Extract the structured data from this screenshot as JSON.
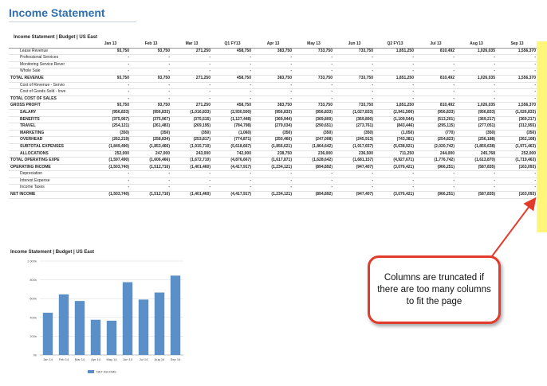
{
  "page": {
    "title": "Income Statement",
    "subtitle": "Income Statement  |  Budget  |  US East"
  },
  "table": {
    "columns": [
      "",
      "Jan 13",
      "Feb 13",
      "Mar 13",
      "Q1 FY13",
      "Apr 13",
      "May 13",
      "Jun 13",
      "Q2 FY13",
      "Jul 13",
      "Aug 13",
      "Sep 13"
    ],
    "rows": [
      {
        "label": "Lease Revenue",
        "level": 1,
        "bold": false,
        "values": [
          "93,750",
          "93,750",
          "271,250",
          "458,750",
          "383,750",
          "733,750",
          "733,750",
          "1,851,250",
          "810,492",
          "1,026,035",
          "1,556,370"
        ]
      },
      {
        "label": "Professional Services",
        "level": 1,
        "bold": false,
        "values": [
          "-",
          "-",
          "-",
          "-",
          "-",
          "-",
          "-",
          "-",
          "-",
          "-",
          "-"
        ]
      },
      {
        "label": "Monitoring Service Rever",
        "level": 1,
        "bold": false,
        "values": [
          "-",
          "-",
          "-",
          "-",
          "-",
          "-",
          "-",
          "-",
          "-",
          "-",
          "-"
        ]
      },
      {
        "label": "Whole Sale",
        "level": 1,
        "bold": false,
        "values": [
          "-",
          "-",
          "-",
          "-",
          "-",
          "-",
          "-",
          "-",
          "-",
          "-",
          "-"
        ]
      },
      {
        "label": "TOTAL REVENUE",
        "level": 0,
        "bold": true,
        "values": [
          "93,750",
          "93,750",
          "271,250",
          "458,750",
          "383,750",
          "733,750",
          "733,750",
          "1,851,250",
          "810,492",
          "1,026,035",
          "1,556,370"
        ]
      },
      {
        "label": "Cost of Revenue - Servio",
        "level": 1,
        "bold": false,
        "values": [
          "-",
          "-",
          "-",
          "-",
          "-",
          "-",
          "-",
          "-",
          "-",
          "-",
          "-"
        ]
      },
      {
        "label": "Cost of Goods Sold - Inve",
        "level": 1,
        "bold": false,
        "values": [
          "-",
          "-",
          "-",
          "-",
          "-",
          "-",
          "-",
          "-",
          "-",
          "-",
          "-"
        ]
      },
      {
        "label": "TOTAL COST OF SALES",
        "level": 0,
        "bold": true,
        "values": [
          "-",
          "-",
          "-",
          "-",
          "-",
          "-",
          "-",
          "-",
          "-",
          "-",
          "-"
        ]
      },
      {
        "label": "GROSS PROFIT",
        "level": 0,
        "bold": true,
        "values": [
          "93,750",
          "93,750",
          "271,250",
          "458,750",
          "383,750",
          "733,750",
          "733,750",
          "1,851,250",
          "810,492",
          "1,026,035",
          "1,556,370"
        ]
      },
      {
        "label": "SALARY",
        "level": 1,
        "bold": true,
        "values": [
          "(956,833)",
          "(956,833)",
          "(1,016,833)",
          "(2,930,500)",
          "(956,833)",
          "(956,833)",
          "(1,027,833)",
          "(2,941,500)",
          "(956,833)",
          "(956,833)",
          "(1,026,833)"
        ]
      },
      {
        "label": "BENEFITS",
        "level": 1,
        "bold": true,
        "values": [
          "(375,967)",
          "(375,967)",
          "(375,515)",
          "(1,127,448)",
          "(369,944)",
          "(369,800)",
          "(369,800)",
          "(1,109,544)",
          "(513,201)",
          "(369,217)",
          "(369,217)"
        ]
      },
      {
        "label": "TRAVEL",
        "level": 1,
        "bold": true,
        "values": [
          "(254,121)",
          "(261,483)",
          "(269,195)",
          "(784,798)",
          "(279,034)",
          "(290,651)",
          "(273,761)",
          "(843,446)",
          "(295,115)",
          "(277,051)",
          "(312,955)"
        ]
      },
      {
        "label": "MARKETING",
        "level": 1,
        "bold": true,
        "values": [
          "(350)",
          "(350)",
          "(350)",
          "(1,060)",
          "(350)",
          "(350)",
          "(350)",
          "(1,050)",
          "(770)",
          "(350)",
          "(350)"
        ]
      },
      {
        "label": "OVERHEAD",
        "level": 1,
        "bold": true,
        "values": [
          "(262,219)",
          "(258,834)",
          "(253,817)",
          "(774,871)",
          "(250,460)",
          "(247,008)",
          "(245,913)",
          "(743,381)",
          "(254,823)",
          "(256,188)",
          "(262,108)"
        ]
      },
      {
        "label": "SUBTOTAL EXPENSES",
        "level": 1,
        "bold": true,
        "values": [
          "(1,849,490)",
          "(1,853,466)",
          "(1,915,710)",
          "(5,618,667)",
          "(1,856,621)",
          "(1,864,642)",
          "(1,917,657)",
          "(5,638,921)",
          "(2,020,742)",
          "(1,859,638)",
          "(1,971,463)"
        ]
      },
      {
        "label": "ALLOCATIONS",
        "level": 1,
        "bold": true,
        "values": [
          "252,000",
          "247,000",
          "243,000",
          "742,000",
          "238,750",
          "236,000",
          "236,500",
          "711,250",
          "244,000",
          "245,768",
          "252,000"
        ]
      },
      {
        "label": "TOTAL OPERATING EXPE",
        "level": 0,
        "bold": true,
        "values": [
          "(1,597,490)",
          "(1,606,466)",
          "(1,672,710)",
          "(4,876,667)",
          "(1,617,871)",
          "(1,628,642)",
          "(1,681,157)",
          "(4,927,671)",
          "(1,776,742)",
          "(1,613,870)",
          "(1,719,463)"
        ]
      },
      {
        "label": "OPERATING INCOME",
        "level": 0,
        "bold": true,
        "values": [
          "(1,503,740)",
          "(1,512,716)",
          "(1,401,460)",
          "(4,417,917)",
          "(1,234,121)",
          "(894,892)",
          "(947,407)",
          "(3,076,421)",
          "(966,251)",
          "(587,835)",
          "(163,093)"
        ]
      },
      {
        "label": "Depreciation",
        "level": 1,
        "bold": false,
        "values": [
          "-",
          "-",
          "-",
          "-",
          "-",
          "-",
          "-",
          "-",
          "-",
          "-",
          "-"
        ]
      },
      {
        "label": "Interest Expense",
        "level": 1,
        "bold": false,
        "values": [
          "-",
          "-",
          "-",
          "-",
          "-",
          "-",
          "-",
          "-",
          "-",
          "-",
          "-"
        ]
      },
      {
        "label": "Income Taxes",
        "level": 1,
        "bold": false,
        "values": [
          "-",
          "-",
          "-",
          "-",
          "-",
          "-",
          "-",
          "-",
          "-",
          "-",
          "-"
        ]
      },
      {
        "label": "NET INCOME",
        "level": 0,
        "bold": true,
        "values": [
          "(1,503,740)",
          "(1,512,716)",
          "(1,401,460)",
          "(4,417,917)",
          "(1,234,121)",
          "(894,892)",
          "(947,407)",
          "(3,076,421)",
          "(966,251)",
          "(587,835)",
          "(163,093)"
        ]
      }
    ]
  },
  "chart_data": {
    "type": "bar",
    "title": "Income Statement | Budget | US East",
    "categories": [
      "Jan 14",
      "Feb 14",
      "Mar 14",
      "Apr 14",
      "May 14",
      "Jun 14",
      "Jul 14",
      "Aug 14",
      "Sep 14"
    ],
    "series": [
      {
        "name": "NET INCOME",
        "values": [
          450000,
          645000,
          575000,
          375000,
          365000,
          775000,
          590000,
          665000,
          845000
        ],
        "color": "#5b8fc7"
      }
    ],
    "yticks": [
      "0k",
      "200k",
      "400k",
      "600k",
      "800k",
      "1 000k"
    ],
    "ylim": [
      0,
      1000000
    ],
    "grid": true,
    "legend": "bottom",
    "xlabel": "",
    "ylabel": ""
  },
  "callout": {
    "text": "Columns are truncated if there are too many columns to fit the page",
    "border_color": "#e23b2b"
  },
  "colors": {
    "title": "#2e6fb0",
    "highlight": "#fff67a",
    "arrow": "#e23b2b"
  }
}
